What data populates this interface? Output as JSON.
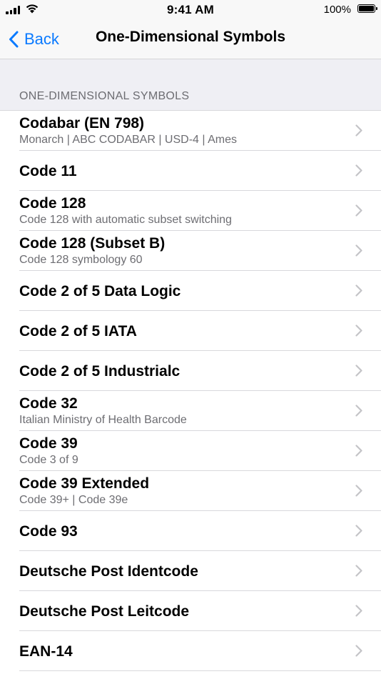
{
  "status_bar": {
    "time": "9:41 AM",
    "battery": "100%"
  },
  "nav": {
    "back_label": "Back",
    "title": "One-Dimensional Symbols"
  },
  "section": {
    "header": "ONE-DIMENSIONAL SYMBOLS"
  },
  "items": [
    {
      "title": "Codabar (EN 798)",
      "subtitle": "Monarch | ABC CODABAR | USD-4 | Ames"
    },
    {
      "title": "Code 11",
      "subtitle": ""
    },
    {
      "title": "Code 128",
      "subtitle": "Code 128 with automatic subset switching"
    },
    {
      "title": "Code 128 (Subset B)",
      "subtitle": "Code 128 symbology 60"
    },
    {
      "title": "Code 2 of 5 Data Logic",
      "subtitle": ""
    },
    {
      "title": "Code 2 of 5 IATA",
      "subtitle": ""
    },
    {
      "title": "Code 2 of 5 Industrialc",
      "subtitle": ""
    },
    {
      "title": "Code 32",
      "subtitle": "Italian Ministry of Health Barcode"
    },
    {
      "title": "Code 39",
      "subtitle": "Code 3 of 9"
    },
    {
      "title": "Code 39 Extended",
      "subtitle": "Code 39+ | Code 39e"
    },
    {
      "title": "Code 93",
      "subtitle": ""
    },
    {
      "title": "Deutsche Post Identcode",
      "subtitle": ""
    },
    {
      "title": "Deutsche Post Leitcode",
      "subtitle": ""
    },
    {
      "title": "EAN-14",
      "subtitle": ""
    }
  ],
  "icons": {
    "back": "chevron-left-icon",
    "row": "chevron-right-icon",
    "signal": "cellular-signal-icon",
    "wifi": "wifi-icon",
    "battery": "battery-icon"
  },
  "colors": {
    "accent": "#0a7aff",
    "secondary_text": "#6d6d72",
    "grouped_bg": "#efeff4"
  }
}
